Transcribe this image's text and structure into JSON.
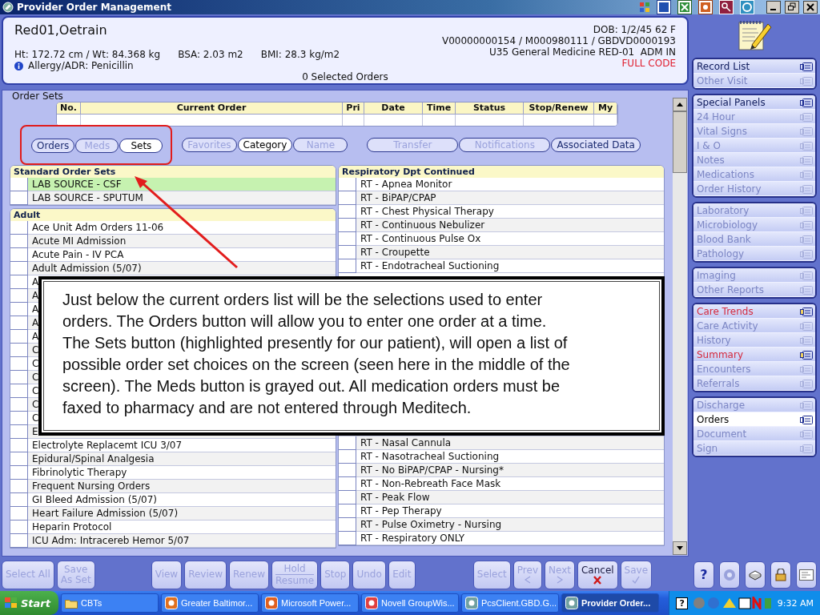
{
  "window": {
    "title": "Provider Order Management"
  },
  "patient": {
    "name": "Red01,Oetrain",
    "measures": [
      "Ht: 172.72 cm / Wt: 84.368 kg",
      "BSA: 2.03 m2",
      "BMI: 28.3 kg/m2"
    ],
    "allergy": "Allergy/ADR: Penicillin",
    "dob": "DOB: 1/2/45 62 F",
    "ids": "V00000000154 / M000980111 / GBDVD0000193",
    "location": "U35 General Medicine RED-01  ADM IN",
    "code_status": "FULL CODE",
    "selected_orders": "0 Selected Orders"
  },
  "order_sets": {
    "title": "Order Sets",
    "columns": [
      "No.",
      "Current Order",
      "Pri",
      "Date",
      "Time",
      "Status",
      "Stop/Renew",
      "My"
    ],
    "button_groups": [
      {
        "highlighted": true,
        "buttons": [
          {
            "label": "Orders",
            "disabled": false,
            "selected": false
          },
          {
            "label": "Meds",
            "disabled": true,
            "selected": false
          },
          {
            "label": "Sets",
            "disabled": false,
            "selected": true
          }
        ]
      },
      {
        "highlighted": false,
        "buttons": [
          {
            "label": "Favorites",
            "disabled": true,
            "selected": false
          },
          {
            "label": "Category",
            "disabled": false,
            "selected": true
          },
          {
            "label": "Name",
            "disabled": true,
            "selected": false
          }
        ]
      },
      {
        "highlighted": false,
        "buttons": [
          {
            "label": "Transfer",
            "disabled": true,
            "selected": false
          },
          {
            "label": "Notifications",
            "disabled": true,
            "selected": false
          },
          {
            "label": "Associated Data",
            "disabled": false,
            "selected": false
          }
        ]
      }
    ],
    "left_groups": [
      {
        "title": "Standard Order Sets",
        "rows": [
          {
            "label": "LAB SOURCE - CSF",
            "selected": true,
            "checked": false
          },
          {
            "label": "LAB SOURCE - SPUTUM",
            "selected": false,
            "checked": false
          }
        ]
      },
      {
        "title": "Adult",
        "rows": [
          {
            "label": "Ace Unit Adm Orders 11-06",
            "selected": false,
            "checked": false
          },
          {
            "label": "Acute MI Admission",
            "selected": false,
            "checked": false
          },
          {
            "label": "Acute Pain - IV PCA",
            "selected": false,
            "checked": false
          },
          {
            "label": "Adult Admission (5/07)",
            "selected": false,
            "checked": false
          },
          {
            "label": "A",
            "selected": false,
            "checked": false
          },
          {
            "label": "A",
            "selected": false,
            "checked": false
          },
          {
            "label": "A",
            "selected": false,
            "checked": false
          },
          {
            "label": "A",
            "selected": false,
            "checked": false
          },
          {
            "label": "A",
            "selected": false,
            "checked": false
          },
          {
            "label": "C",
            "selected": false,
            "checked": false
          },
          {
            "label": "C",
            "selected": false,
            "checked": false
          },
          {
            "label": "C",
            "selected": false,
            "checked": false
          },
          {
            "label": "C",
            "selected": false,
            "checked": false
          },
          {
            "label": "C",
            "selected": false,
            "checked": false
          },
          {
            "label": "C",
            "selected": false,
            "checked": false
          },
          {
            "label": "E",
            "selected": false,
            "checked": false
          },
          {
            "label": "Electrolyte Replacemt ICU 3/07",
            "selected": false,
            "checked": false
          },
          {
            "label": "Epidural/Spinal Analgesia",
            "selected": false,
            "checked": false
          },
          {
            "label": "Fibrinolytic Therapy",
            "selected": false,
            "checked": false
          },
          {
            "label": "Frequent Nursing Orders",
            "selected": false,
            "checked": false
          },
          {
            "label": "GI Bleed Admission (5/07)",
            "selected": false,
            "checked": false
          },
          {
            "label": "Heart Failure Admission (5/07)",
            "selected": false,
            "checked": false
          },
          {
            "label": "Heparin Protocol",
            "selected": false,
            "checked": false
          },
          {
            "label": "ICU Adm: Intracereb Hemor 5/07",
            "selected": false,
            "checked": false
          }
        ]
      }
    ],
    "right_group": {
      "title": "Respiratory Dpt Continued",
      "rows": [
        {
          "label": "RT - Apnea Monitor",
          "selected": false,
          "checked": false
        },
        {
          "label": "RT - BiPAP/CPAP",
          "selected": false,
          "checked": false
        },
        {
          "label": "RT - Chest Physical Therapy",
          "selected": false,
          "checked": false
        },
        {
          "label": "RT - Continuous Nebulizer",
          "selected": false,
          "checked": false
        },
        {
          "label": "RT - Continuous Pulse Ox",
          "selected": false,
          "checked": false
        },
        {
          "label": "RT - Croupette",
          "selected": false,
          "checked": false
        },
        {
          "label": "RT - Endotracheal Suctioning",
          "selected": false,
          "checked": false
        }
      ],
      "rows_below": [
        {
          "label": "RT - Nasal Cannula",
          "selected": false,
          "checked": false
        },
        {
          "label": "RT - Nasotracheal Suctioning",
          "selected": false,
          "checked": false
        },
        {
          "label": "RT - No BiPAP/CPAP - Nursing*",
          "selected": false,
          "checked": false
        },
        {
          "label": "RT - Non-Rebreath Face Mask",
          "selected": false,
          "checked": false
        },
        {
          "label": "RT - Peak Flow",
          "selected": false,
          "checked": false
        },
        {
          "label": "RT - Pep Therapy",
          "selected": false,
          "checked": false
        },
        {
          "label": "RT - Pulse Oximetry - Nursing",
          "selected": false,
          "checked": false
        },
        {
          "label": "RT - Respiratory ONLY",
          "selected": false,
          "checked": false
        }
      ]
    }
  },
  "callout": "Just below the current orders list will be the selections used to enter\n orders. The Orders button will allow you to enter one order at a time.\n The Sets button (highlighted presently for our patient), will open a list of\n possible order set choices on the screen (seen here in the middle of the\n screen). The Meds button is grayed out. All medication orders must be\n faxed to pharmacy and are not entered through Meditech.",
  "sidebar": {
    "groups": [
      [
        {
          "label": "Record List",
          "disabled": false,
          "highlight": false,
          "selected": false
        },
        {
          "label": "Other Visit",
          "disabled": true,
          "highlight": false,
          "selected": false
        }
      ],
      [
        {
          "label": "Special Panels",
          "disabled": false,
          "highlight": false,
          "selected": false
        },
        {
          "label": "24 Hour",
          "disabled": true,
          "highlight": false,
          "selected": false
        },
        {
          "label": "Vital Signs",
          "disabled": true,
          "highlight": false,
          "selected": false
        },
        {
          "label": "I & O",
          "disabled": true,
          "highlight": false,
          "selected": false
        },
        {
          "label": "Notes",
          "disabled": true,
          "highlight": false,
          "selected": false
        },
        {
          "label": "Medications",
          "disabled": true,
          "highlight": false,
          "selected": false
        },
        {
          "label": "Order History",
          "disabled": true,
          "highlight": false,
          "selected": false
        }
      ],
      [
        {
          "label": "Laboratory",
          "disabled": true,
          "highlight": false,
          "selected": false
        },
        {
          "label": "Microbiology",
          "disabled": true,
          "highlight": false,
          "selected": false
        },
        {
          "label": "Blood Bank",
          "disabled": true,
          "highlight": false,
          "selected": false
        },
        {
          "label": "Pathology",
          "disabled": true,
          "highlight": false,
          "selected": false
        }
      ],
      [
        {
          "label": "Imaging",
          "disabled": true,
          "highlight": false,
          "selected": false
        },
        {
          "label": "Other Reports",
          "disabled": true,
          "highlight": false,
          "selected": false
        }
      ],
      [
        {
          "label": "Care Trends",
          "disabled": false,
          "highlight": true,
          "selected": false
        },
        {
          "label": "Care Activity",
          "disabled": true,
          "highlight": false,
          "selected": false
        },
        {
          "label": "History",
          "disabled": true,
          "highlight": false,
          "selected": false
        },
        {
          "label": "Summary",
          "disabled": false,
          "highlight": true,
          "selected": false
        },
        {
          "label": "Encounters",
          "disabled": true,
          "highlight": false,
          "selected": false
        },
        {
          "label": "Referrals",
          "disabled": true,
          "highlight": false,
          "selected": false
        }
      ],
      [
        {
          "label": "Discharge",
          "disabled": true,
          "highlight": false,
          "selected": false
        },
        {
          "label": "Orders",
          "disabled": false,
          "highlight": false,
          "selected": true
        },
        {
          "label": "Document",
          "disabled": true,
          "highlight": false,
          "selected": false
        },
        {
          "label": "Sign",
          "disabled": true,
          "highlight": false,
          "selected": false
        }
      ]
    ]
  },
  "bottom_bar": {
    "groups": [
      [
        {
          "kind": "plain",
          "label": "Select All",
          "disabled": true
        },
        {
          "kind": "plain",
          "label": "Save\nAs Set",
          "disabled": true
        }
      ],
      [
        {
          "kind": "plain",
          "label": "View",
          "disabled": true
        },
        {
          "kind": "plain",
          "label": "Review",
          "disabled": true
        },
        {
          "kind": "plain",
          "label": "Renew",
          "disabled": true
        },
        {
          "kind": "split",
          "label": "Hold",
          "sublabel": "Resume",
          "disabled": true
        },
        {
          "kind": "plain",
          "label": "Stop",
          "disabled": true
        },
        {
          "kind": "plain",
          "label": "Undo",
          "disabled": true
        },
        {
          "kind": "plain",
          "label": "Edit",
          "disabled": true
        }
      ],
      [
        {
          "kind": "plain",
          "label": "Select",
          "disabled": true
        },
        {
          "kind": "back",
          "label": "Prev",
          "disabled": true
        },
        {
          "kind": "forward",
          "label": "Next",
          "disabled": true
        },
        {
          "kind": "cancel",
          "label": "Cancel",
          "disabled": false
        },
        {
          "kind": "confirm",
          "label": "Save",
          "disabled": true
        }
      ]
    ],
    "help": "?"
  },
  "taskbar": {
    "start": "Start",
    "tasks": [
      {
        "label": "CBTs",
        "selected": false
      },
      {
        "label": "Greater Baltimor...",
        "selected": false
      },
      {
        "label": "Microsoft Power...",
        "selected": false
      },
      {
        "label": "Novell GroupWis...",
        "selected": false
      },
      {
        "label": "PcsClient.GBD.G...",
        "selected": false
      },
      {
        "label": "Provider Order...",
        "selected": true
      }
    ],
    "tray_help": "?",
    "time": "9:32 AM"
  }
}
